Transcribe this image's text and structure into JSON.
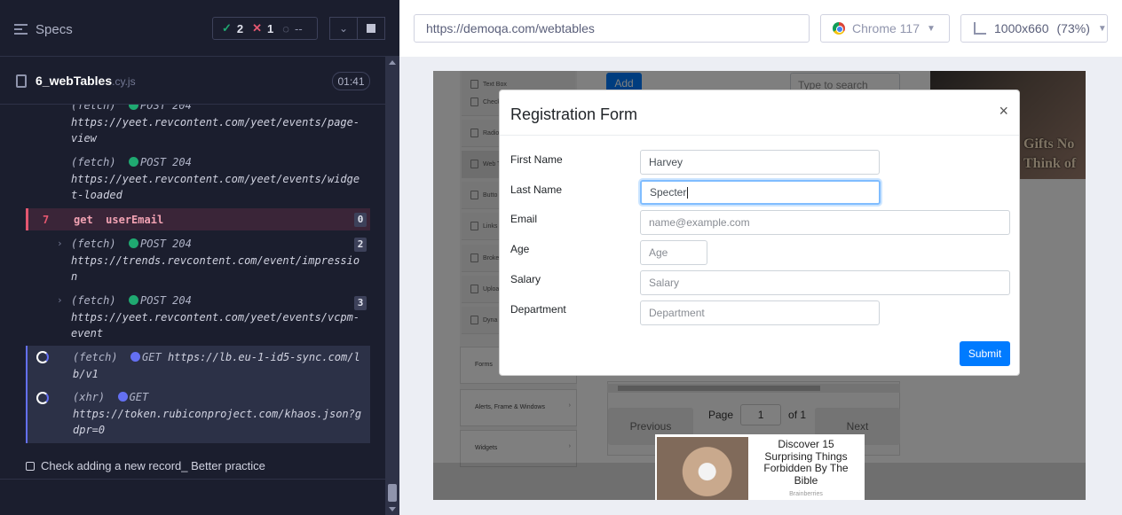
{
  "reporter": {
    "specs_label": "Specs",
    "stats": {
      "passed": "2",
      "failed": "1",
      "pending": "--"
    },
    "spec": {
      "name": "6_webTables",
      "ext": ".cy.js",
      "duration": "01:41"
    },
    "commands": [
      {
        "kind": "(fetch)",
        "method": "POST 204",
        "url": "https://yeet.revcontent.com/yeet/events/page-view"
      },
      {
        "kind": "(fetch)",
        "method": "POST 204",
        "url": "https://yeet.revcontent.com/yeet/events/widget-loaded"
      },
      {
        "num": "7",
        "kind": "get",
        "arg": "userEmail",
        "count": "0"
      },
      {
        "kind": "(fetch)",
        "method": "POST 204",
        "url": "https://trends.revcontent.com/event/impression",
        "count": "2"
      },
      {
        "kind": "(fetch)",
        "method": "POST 204",
        "url": "https://yeet.revcontent.com/yeet/events/vcpm-event",
        "count": "3"
      },
      {
        "kind": "(fetch)",
        "method": "GET",
        "url": "https://lb.eu-1-id5-sync.com/lb/v1"
      },
      {
        "kind": "(xhr)",
        "method": "GET",
        "url": "https://token.rubiconproject.com/khaos.json?gdpr=0"
      }
    ],
    "test_title": "Check adding a new record_ Better practice"
  },
  "runner": {
    "url": "https://demoqa.com/webtables",
    "browser": "Chrome 117",
    "viewport": "1000x660",
    "zoom": "(73%)"
  },
  "aut": {
    "add_label": "Add",
    "search_placeholder": "Type to search",
    "ad_top_text": "Gifts No\nThink of",
    "sidebar_items": [
      "Text Box",
      "Check",
      "Radio",
      "Web T",
      "Butto",
      "Links",
      "Broke",
      "Uploa",
      "Dyna"
    ],
    "sidebar_groups": [
      "Forms",
      "Alerts, Frame & Windows",
      "Widgets"
    ],
    "pagination": {
      "previous": "Previous",
      "next": "Next",
      "page_label": "Page",
      "page_value": "1",
      "of_label": "of 1"
    },
    "ad_bottom": {
      "text": "Discover 15 Surprising Things Forbidden By The Bible",
      "brand": "Brainberries"
    },
    "modal": {
      "title": "Registration Form",
      "close": "×",
      "labels": {
        "first_name": "First Name",
        "last_name": "Last Name",
        "email": "Email",
        "age": "Age",
        "salary": "Salary",
        "department": "Department"
      },
      "values": {
        "first_name": "Harvey",
        "last_name": "Specter"
      },
      "placeholders": {
        "email": "name@example.com",
        "age": "Age",
        "salary": "Salary",
        "department": "Department"
      },
      "submit": "Submit"
    }
  },
  "colors": {
    "reporter_bg": "#1b1e2e",
    "passed": "#1fa971",
    "failed": "#e45770",
    "pending": "#6470f3",
    "primary": "#007bff"
  }
}
